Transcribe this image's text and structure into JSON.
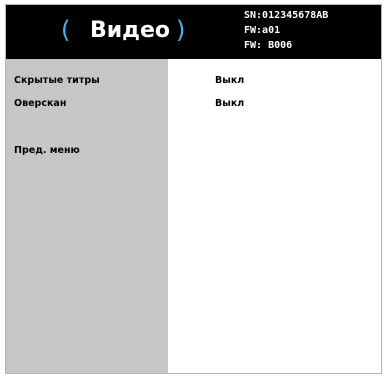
{
  "header": {
    "title": "Видео",
    "bracket_left": "(",
    "bracket_right": ")",
    "info_lines": [
      "SN:012345678AB",
      "FW:a01",
      "FW: B006"
    ],
    "accent_color": "#3db8ee"
  },
  "menu": {
    "items": [
      {
        "label": "Скрытые титры",
        "value": "Выкл"
      },
      {
        "label": "Оверскан",
        "value": "Выкл"
      },
      {
        "label": "Пред. меню"
      }
    ]
  }
}
